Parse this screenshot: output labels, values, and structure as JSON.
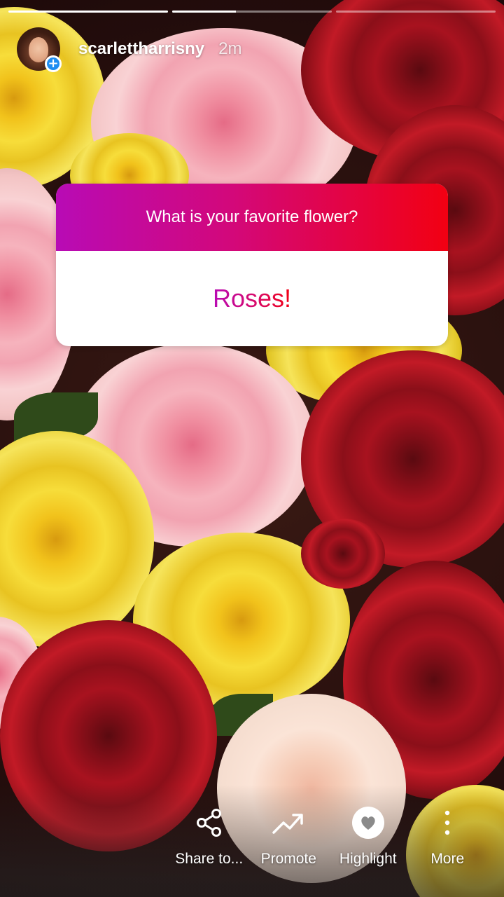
{
  "story": {
    "progress": [
      {
        "fill_fraction": 1.0
      },
      {
        "fill_fraction": 0.4
      },
      {
        "fill_fraction": 0.0
      }
    ]
  },
  "header": {
    "username": "scarlettharrisny",
    "timestamp": "2m",
    "avatar_icon": "user-avatar",
    "follow_badge_icon": "plus-icon",
    "follow_badge_symbol": "+",
    "follow_badge_color": "#1f8ef1"
  },
  "question_sticker": {
    "question": "What is your favorite flower?",
    "answer": "Roses!",
    "gradient_start": "#b80bb5",
    "gradient_end": "#f20012"
  },
  "actions": [
    {
      "label": "Share to...",
      "icon": "share-icon"
    },
    {
      "label": "Promote",
      "icon": "trending-up-icon"
    },
    {
      "label": "Highlight",
      "icon": "heart-circle-icon"
    },
    {
      "label": "More",
      "icon": "more-vertical-icon"
    }
  ]
}
